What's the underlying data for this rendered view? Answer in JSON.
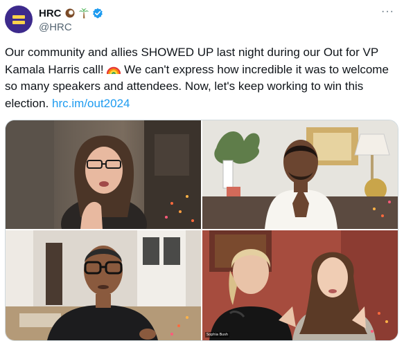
{
  "account": {
    "name": "HRC",
    "handle": "@HRC",
    "name_emojis": [
      "coconut-icon",
      "palm-tree-icon"
    ],
    "verified": true,
    "brand_color": "#3d2a8c",
    "logo_color": "#f9d24a",
    "verified_color": "#1d9bf0"
  },
  "post": {
    "text_part1": "Our community and allies SHOWED UP last night during our Out for VP Kamala Harris call! ",
    "text_part2": " We can't express how incredible it was to welcome so many speakers and attendees. Now, let's keep working to win this election. ",
    "link_text": "hrc.im/out2024",
    "link_color": "#1d9bf0"
  },
  "media": {
    "tiles": [
      {
        "name": "video-tile-1"
      },
      {
        "name": "video-tile-2"
      },
      {
        "name": "video-tile-3"
      },
      {
        "name": "video-tile-4",
        "caption": "Sophia Bush"
      }
    ]
  },
  "more_label": "···"
}
